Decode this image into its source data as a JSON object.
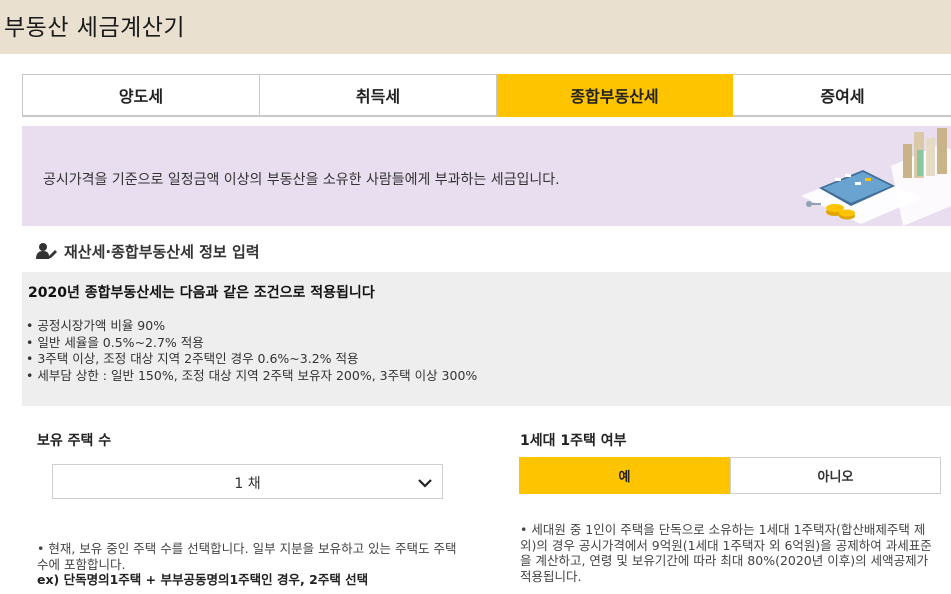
{
  "window": {
    "title": "부동산 세금계산기"
  },
  "tabs": [
    {
      "label": "양도세"
    },
    {
      "label": "취득세"
    },
    {
      "label": "종합부동산세"
    },
    {
      "label": "증여세"
    }
  ],
  "active_tab": "종합부동산세",
  "banner": {
    "description": "공시가격을 기준으로 일정금액 이상의 부동산을 소유한 사람들에게 부과하는 세금입니다."
  },
  "section": {
    "title": "재산세·종합부동산세 정보 입력"
  },
  "info": {
    "heading": "2020년 종합부동산세는 다음과 같은 조건으로 적용됩니다",
    "items": [
      "공정시장가액 비율 90%",
      "일반 세율을 0.5%~2.7% 적용",
      "3주택 이상, 조정 대상 지역 2주택인 경우 0.6%~3.2% 적용",
      "세부담 상한 : 일반 150%, 조정 대상 지역 2주택 보유자 200%, 3주택 이상 300%"
    ]
  },
  "houses": {
    "label": "보유 주택 수",
    "selected": "1 채",
    "note_line1": "• 현재, 보유 중인 주택 수를 선택합니다. 일부 지분을 보유하고 있는 주택도 주택 수에 포함합니다.",
    "note_example": "ex) 단독명의1주택 + 부부공동명의1주택인 경우, 2주택 선택"
  },
  "one_house": {
    "label": "1세대 1주택 여부",
    "yes": "예",
    "no": "아니오",
    "selected": "예",
    "note": "• 세대원 중 1인이 주택을 단독으로 소유하는 1세대 1주택자(합산배제주택 제외)의 경우 공시가격에서 9억원(1세대 1주택자 외 6억원)을 공제하여 과세표준을 계산하고, 연령 및 보유기간에 따라 최대 80%(2020년 이후)의 세액공제가 적용됩니다."
  },
  "colors": {
    "accent": "#ffc400",
    "titlebar": "#e9e0cf",
    "banner": "#e9ddf0",
    "info_bg": "#eeeeee"
  }
}
